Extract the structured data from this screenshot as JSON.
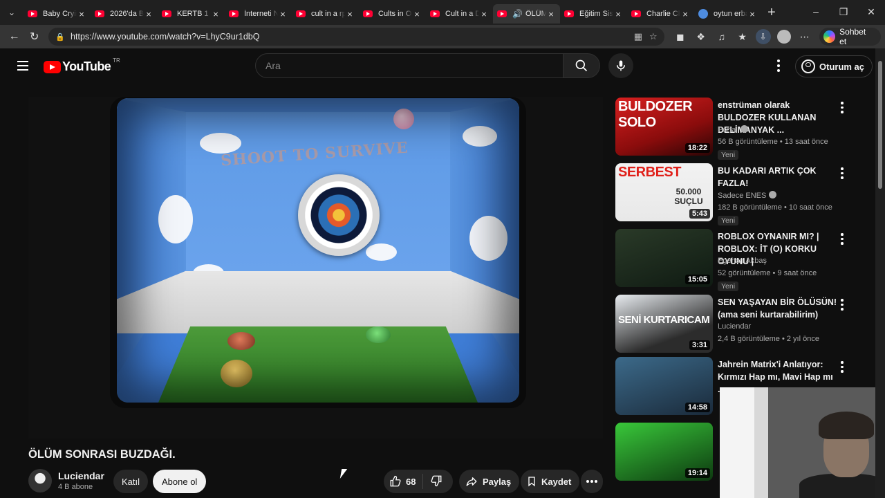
{
  "browser": {
    "tabs": [
      {
        "label": "Baby Crying",
        "active": false
      },
      {
        "label": "2026'da Bil",
        "active": false
      },
      {
        "label": "KERTB 1 - Y",
        "active": false
      },
      {
        "label": "İnterneti N",
        "active": false
      },
      {
        "label": "cult in a rp",
        "active": false
      },
      {
        "label": "Cults in On",
        "active": false
      },
      {
        "label": "Cult in a Da",
        "active": false
      },
      {
        "label": "ÖLÜM",
        "active": true
      },
      {
        "label": "Eğitim Siste",
        "active": false
      },
      {
        "label": "Charlie Clo",
        "active": false
      },
      {
        "label": "oytun erba",
        "active": false
      }
    ],
    "url": "https://www.youtube.com/watch?v=LhyC9ur1dbQ",
    "copilot_label": "Sohbet et"
  },
  "header": {
    "logo_text": "YouTube",
    "region": "TR",
    "search_placeholder": "Ara",
    "signin_label": "Oturum aç"
  },
  "video": {
    "scene_text": "SHOOT TO SURVIVE",
    "title": "ÖLÜM SONRASI BUZDAĞI.",
    "channel": "Luciendar",
    "subscribers": "4 B abone",
    "join_label": "Katıl",
    "subscribe_label": "Abone ol",
    "likes": "68",
    "share_label": "Paylaş",
    "save_label": "Kaydet"
  },
  "recommendations": [
    {
      "title": "enstrüman olarak BULDOZER KULLANAN DELİMANYAK ...",
      "channel": "Portal",
      "verified": true,
      "meta": "56 B görüntüleme • 13 saat önce",
      "badge": "Yeni",
      "duration": "18:22",
      "thumb_text": "BULDOZER SOLO"
    },
    {
      "title": "BU KADARI ARTIK ÇOK FAZLA!",
      "channel": "Sadece ENES",
      "verified": true,
      "meta": "182 B görüntüleme • 10 saat önce",
      "badge": "Yeni",
      "duration": "5:43",
      "thumb_text": "SERBEST",
      "thumb_text2": "50.000 SUÇLU"
    },
    {
      "title": "ROBLOX OYNANIR MI? | ROBLOX: İT (O) KORKU OYUNU |",
      "channel": "Egehan Akbaş",
      "verified": false,
      "meta": "52 görüntüleme • 9 saat önce",
      "badge": "Yeni",
      "duration": "15:05"
    },
    {
      "title": "SEN YAŞAYAN BİR ÖLÜSÜN! (ama seni kurtarabilirim)",
      "channel": "Luciendar",
      "verified": false,
      "meta": "2,4 B görüntüleme • 2 yıl önce",
      "badge": "",
      "duration": "3:31",
      "thumb_text": "SENİ KURTARICAM"
    },
    {
      "title": "Jahrein Matrix'i Anlatıyor: Kırmızı Hap mı, Mavi Hap mı ...",
      "channel": "",
      "verified": false,
      "meta": "",
      "badge": "",
      "duration": "14:58"
    },
    {
      "title": "",
      "channel": "",
      "verified": false,
      "meta": "",
      "badge": "",
      "duration": "19:14"
    }
  ],
  "colors": {
    "background": "#0f0f0f",
    "brand_red": "#ff0000",
    "text_primary": "#f1f1f1",
    "text_secondary": "#aaaaaa"
  }
}
